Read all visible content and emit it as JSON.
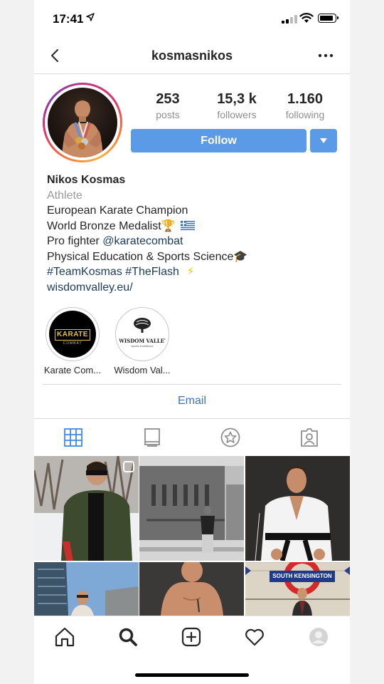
{
  "status_bar": {
    "time": "17:41",
    "location_icon": "location-arrow-icon"
  },
  "header": {
    "username": "kosmasnikos",
    "back_icon": "chevron-left-icon",
    "more_icon": "more-dots-icon"
  },
  "profile": {
    "avatar_icon": "profile-photo",
    "stats": [
      {
        "value": "253",
        "label": "posts"
      },
      {
        "value": "15,3 k",
        "label": "followers"
      },
      {
        "value": "1.160",
        "label": "following"
      }
    ],
    "follow_label": "Follow",
    "dropdown_icon": "caret-down-icon"
  },
  "bio": {
    "name": "Nikos Kosmas",
    "category": "Athlete",
    "line1": "European Karate Champion",
    "line2_text": "World Bronze Medalist",
    "line2_emoji": "🏆",
    "line3_prefix": "Pro fighter ",
    "line3_mention": "@karatecombat",
    "line4_text": "Physical Education & Sports Science",
    "line4_emoji": "🎓",
    "line5_tags": "#TeamKosmas #TheFlash",
    "line5_emoji": "⚡",
    "website": "wisdomvalley.eu/"
  },
  "highlights": [
    {
      "label": "Karate Com...",
      "logo_text": "KARATE",
      "logo_sub": "COMBAT"
    },
    {
      "label": "Wisdom Val...",
      "logo_text": "WISDOM VALLEY",
      "logo_sub": "sports-excellence"
    }
  ],
  "contact": {
    "email_label": "Email"
  },
  "tabs": [
    {
      "icon": "grid-icon",
      "active": true
    },
    {
      "icon": "igtv-icon",
      "active": false
    },
    {
      "icon": "star-icon",
      "active": false
    },
    {
      "icon": "tagged-person-icon",
      "active": false
    }
  ],
  "grid_posts": [
    {
      "sign_text": ""
    },
    {
      "sign_text": ""
    },
    {
      "sign_text": ""
    },
    {
      "sign_text": ""
    },
    {
      "sign_text": ""
    },
    {
      "sign_text": "SOUTH KENSINGTON"
    }
  ],
  "bottom_nav": [
    "home-icon",
    "search-icon",
    "add-post-icon",
    "heart-icon",
    "profile-icon"
  ],
  "colors": {
    "accent": "#5a9ae6",
    "link": "#3f74b3",
    "tag": "#1a3a5e"
  }
}
